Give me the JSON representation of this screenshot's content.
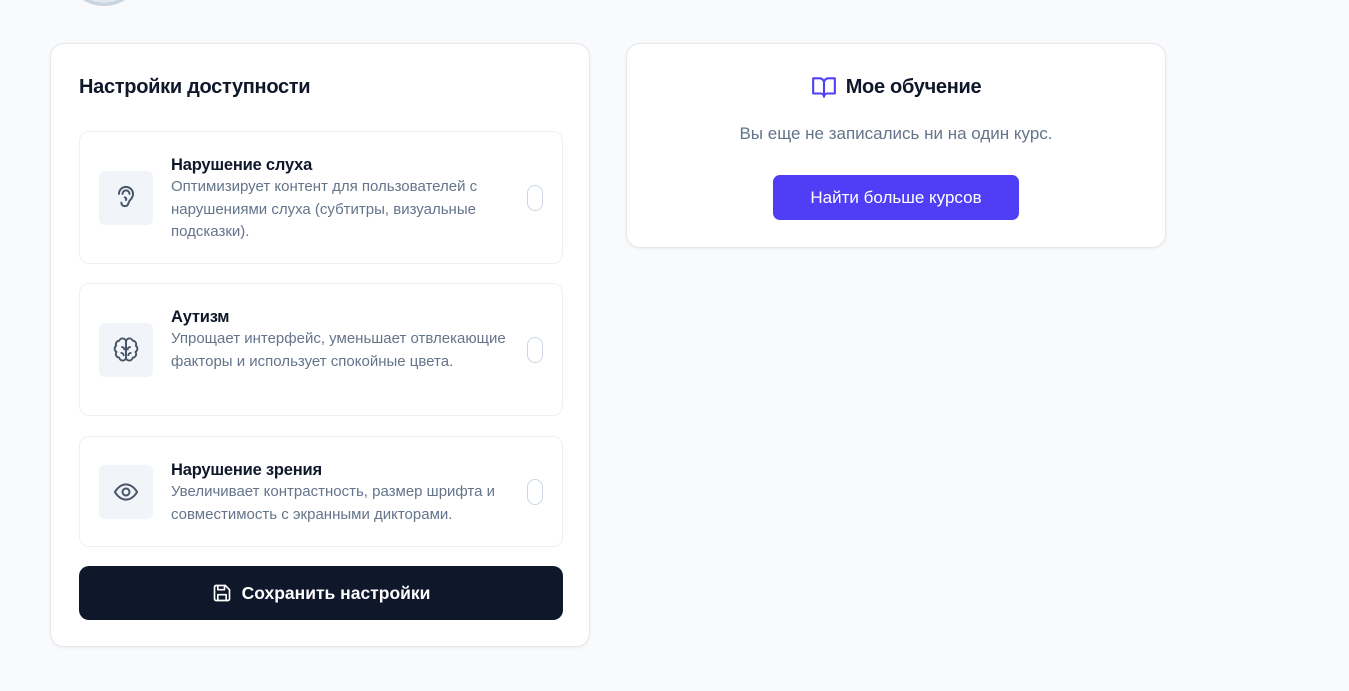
{
  "colors": {
    "accent": "#4f3ef5",
    "primary_dark": "#0f172a",
    "muted_text": "#64748b",
    "icon_bg": "#f1f5f9",
    "icon_stroke": "#475569"
  },
  "accessibility": {
    "title": "Настройки доступности",
    "options": [
      {
        "icon": "ear-icon",
        "title": "Нарушение слуха",
        "description": "Оптимизирует контент для пользователей с нарушениями слуха (субтитры, визуальные подсказки).",
        "enabled": false
      },
      {
        "icon": "brain-icon",
        "title": "Аутизм",
        "description": "Упрощает интерфейс, уменьшает отвлекающие факторы и использует спокойные цвета.",
        "enabled": false
      },
      {
        "icon": "eye-icon",
        "title": "Нарушение зрения",
        "description": "Увеличивает контрастность, размер шрифта и совместимость с экранными дикторами.",
        "enabled": false
      }
    ],
    "save_icon": "save-icon",
    "save_label": "Сохранить настройки"
  },
  "learning": {
    "icon": "book-open-icon",
    "title": "Мое обучение",
    "empty_text": "Вы еще не записались ни на один курс.",
    "find_label": "Найти больше курсов"
  }
}
